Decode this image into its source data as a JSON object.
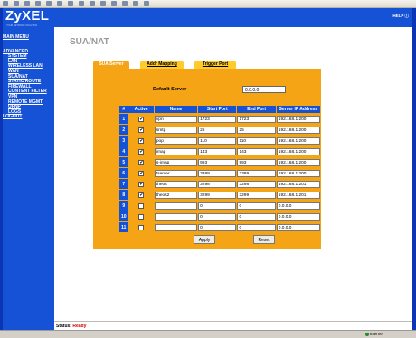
{
  "browser": {
    "toolbar_icons": [
      "back-icon",
      "forward-icon",
      "stop-icon",
      "refresh-icon",
      "home-icon",
      "search-icon",
      "favorites-icon",
      "media-icon",
      "history-icon",
      "mail-icon",
      "print-icon",
      "edit-icon",
      "discuss-icon",
      "messenger-icon"
    ]
  },
  "logo": {
    "text": "ZyXEL",
    "sub": "YOUR NETWORK SOLUTION"
  },
  "help": "HELP ⓘ",
  "nav": {
    "main_menu": "MAIN MENU",
    "advanced": "ADVANCED",
    "items": [
      "SYSTEM",
      "LAN",
      "WIRELESS LAN",
      "WAN",
      "SUA/NAT",
      "STATIC ROUTE",
      "FIREWALL",
      "CONTENT FILTER",
      "VPN",
      "REMOTE MGMT",
      "UPNP",
      "LOGS"
    ],
    "logout": "LOGOUT"
  },
  "page_title": "SUA/NAT",
  "tabs": [
    "SUA Server",
    "Addr Mapping",
    "Trigger Port"
  ],
  "default_server": {
    "label": "Default Server",
    "value": "0.0.0.0"
  },
  "table": {
    "headers": [
      "#",
      "Active",
      "Name",
      "Start Port",
      "End Port",
      "Server IP Address"
    ],
    "rows": [
      {
        "n": "1",
        "active": true,
        "name": "vpn",
        "start": "1723",
        "end": "1723",
        "ip": "192.168.1.200"
      },
      {
        "n": "2",
        "active": true,
        "name": "smtp",
        "start": "25",
        "end": "25",
        "ip": "192.168.1.200"
      },
      {
        "n": "3",
        "active": true,
        "name": "pop",
        "start": "110",
        "end": "110",
        "ip": "192.168.1.200"
      },
      {
        "n": "4",
        "active": true,
        "name": "imap",
        "start": "143",
        "end": "143",
        "ip": "192.168.1.200"
      },
      {
        "n": "5",
        "active": true,
        "name": "s-imap",
        "start": "993",
        "end": "993",
        "ip": "192.168.1.200"
      },
      {
        "n": "6",
        "active": true,
        "name": "tserver",
        "start": "3389",
        "end": "3389",
        "ip": "192.168.1.200"
      },
      {
        "n": "7",
        "active": true,
        "name": "theos",
        "start": "3298",
        "end": "3298",
        "ip": "192.168.1.201"
      },
      {
        "n": "8",
        "active": true,
        "name": "theos2",
        "start": "3299",
        "end": "3299",
        "ip": "192.168.1.201"
      },
      {
        "n": "9",
        "active": false,
        "name": "",
        "start": "0",
        "end": "0",
        "ip": "0.0.0.0"
      },
      {
        "n": "10",
        "active": false,
        "name": "",
        "start": "0",
        "end": "0",
        "ip": "0.0.0.0"
      },
      {
        "n": "11",
        "active": false,
        "name": "",
        "start": "0",
        "end": "0",
        "ip": "0.0.0.0"
      }
    ]
  },
  "buttons": {
    "apply": "Apply",
    "reset": "Reset"
  },
  "status": {
    "label": "Status:",
    "value": "Ready"
  },
  "statusbar": {
    "zone": "Internet"
  },
  "colors": {
    "brand_blue": "#1652d6",
    "panel_orange": "#f5a415",
    "tab_yellow": "#ffca2c",
    "status_red": "#cc0000"
  }
}
